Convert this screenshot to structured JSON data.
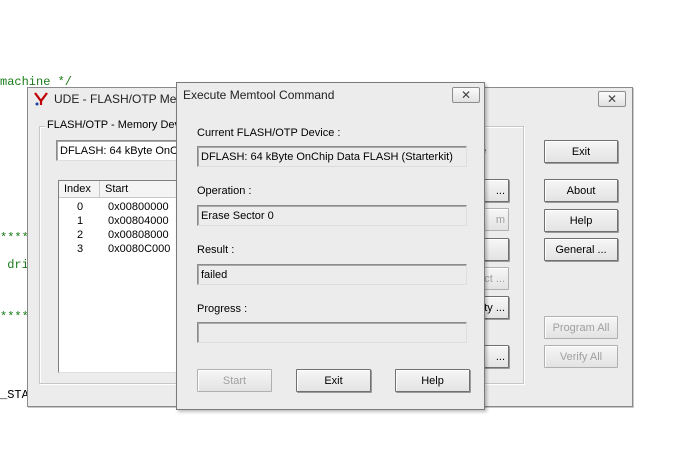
{
  "background_code": {
    "line1": "machine */",
    "line2": "*****",
    "line3": " dri",
    "line4": "*****",
    "line5": "_STA"
  },
  "ude_window": {
    "title": "UDE - FLASH/OTP Mem",
    "close_glyph": "✕",
    "group_label": "FLASH/OTP - Memory Dev",
    "device_select": "DFLASH: 64 kByte OnCh",
    "table": {
      "headers": [
        "Index",
        "Start"
      ],
      "rows": [
        {
          "index": "0",
          "start": "0x00800000"
        },
        {
          "index": "1",
          "start": "0x00804000"
        },
        {
          "index": "2",
          "start": "0x00808000"
        },
        {
          "index": "3",
          "start": "0x0080C000"
        }
      ]
    },
    "partial_right_label": "e",
    "partial_buttons": [
      "...",
      "m",
      "",
      "ct ...",
      "ty ...",
      "..."
    ],
    "buttons": {
      "exit": "Exit",
      "about": "About",
      "help": "Help",
      "general": "General ...",
      "program_all": "Program All",
      "verify_all": "Verify All"
    }
  },
  "dialog": {
    "title": "Execute Memtool Command",
    "close_glyph": "✕",
    "device_label": "Current FLASH/OTP Device :",
    "device_value": "DFLASH: 64 kByte OnChip Data FLASH (Starterkit)",
    "operation_label": "Operation :",
    "operation_value": "Erase Sector 0",
    "result_label": "Result :",
    "result_value": "failed",
    "progress_label": "Progress :",
    "progress_value": "",
    "buttons": {
      "start": "Start",
      "exit": "Exit",
      "help": "Help"
    }
  }
}
